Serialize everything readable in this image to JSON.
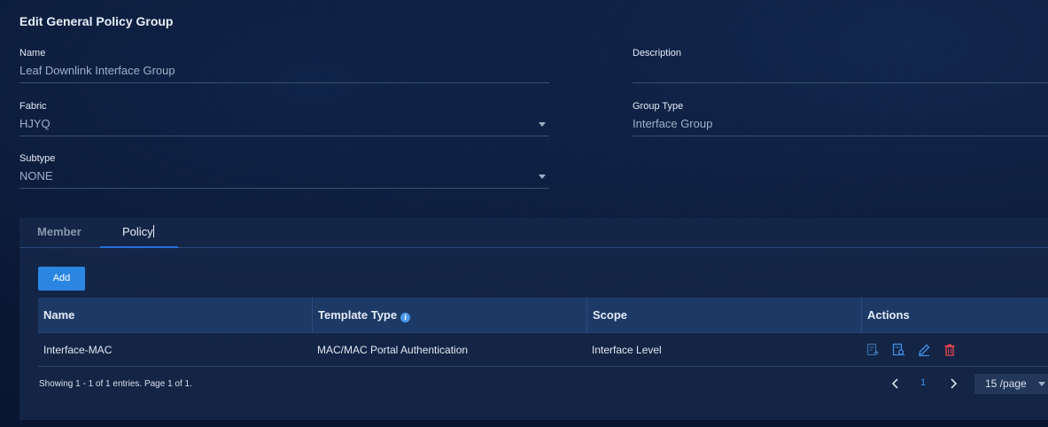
{
  "page": {
    "title": "Edit General Policy Group"
  },
  "form": {
    "name": {
      "label": "Name",
      "value": "Leaf Downlink Interface Group"
    },
    "description": {
      "label": "Description",
      "value": ""
    },
    "fabric": {
      "label": "Fabric",
      "value": "HJYQ"
    },
    "group_type": {
      "label": "Group Type",
      "value": "Interface Group"
    },
    "subtype": {
      "label": "Subtype",
      "value": "NONE"
    }
  },
  "tabs": [
    {
      "label": "Member",
      "active": false
    },
    {
      "label": "Policy",
      "active": true
    }
  ],
  "toolbar": {
    "add_label": "Add"
  },
  "table": {
    "columns": [
      "Name",
      "Template Type",
      "Scope",
      "Actions"
    ],
    "rows": [
      {
        "name": "Interface-MAC",
        "template_type": "MAC/MAC Portal Authentication",
        "scope": "Interface Level",
        "actions": [
          "apply-icon",
          "view-icon",
          "edit-icon",
          "delete-icon"
        ]
      }
    ]
  },
  "pagination": {
    "summary": "Showing 1 - 1 of 1 entries. Page 1 of 1.",
    "current_page": "1",
    "page_size": "15 /page"
  },
  "colors": {
    "accent": "#2a86e2",
    "delete": "#e0434f",
    "active_page": "#3b8eea"
  }
}
